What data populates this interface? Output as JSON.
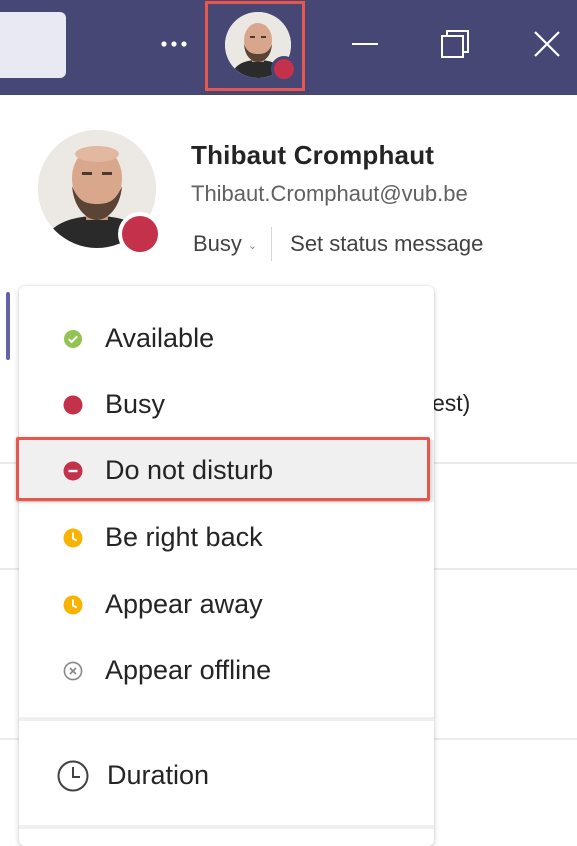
{
  "titlebar": {
    "background": "#464775",
    "more_icon": "more-horizontal-icon",
    "avatar_presence": "busy",
    "window_controls": [
      "minimize-icon",
      "maximize-icon",
      "close-icon"
    ]
  },
  "profile": {
    "name": "Thibaut Cromphaut",
    "email": "Thibaut.Cromphaut@vub.be",
    "status": "Busy",
    "set_status_label": "Set status message",
    "presence_color": "#c4314b"
  },
  "background": {
    "partial_text": "est)"
  },
  "status_menu": {
    "items": [
      {
        "label": "Available",
        "icon": "available-check-icon",
        "color": "#92c353"
      },
      {
        "label": "Busy",
        "icon": "busy-dot-icon",
        "color": "#c4314b"
      },
      {
        "label": "Do not disturb",
        "icon": "do-not-disturb-icon",
        "color": "#c4314b"
      },
      {
        "label": "Be right back",
        "icon": "clock-icon",
        "color": "#f8b300"
      },
      {
        "label": "Appear away",
        "icon": "clock-icon",
        "color": "#f8b300"
      },
      {
        "label": "Appear offline",
        "icon": "offline-x-icon",
        "color": "#8a8886"
      }
    ],
    "highlighted": "Do not disturb",
    "duration_label": "Duration"
  }
}
